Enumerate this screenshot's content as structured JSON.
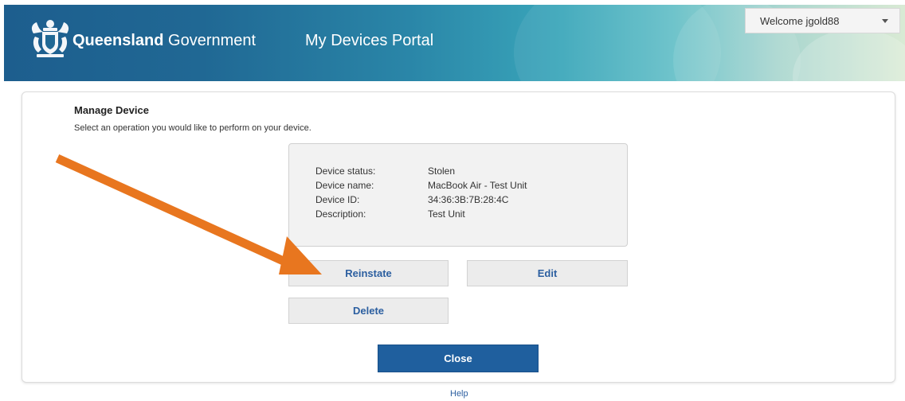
{
  "header": {
    "brand_strong": "Queensland",
    "brand_light": " Government",
    "portal_title": "My Devices Portal",
    "crest_icon": "queensland-crest-icon",
    "user_menu_label": "Welcome jgold88"
  },
  "panel": {
    "title": "Manage Device",
    "subtitle": "Select an operation you would like to perform on your device."
  },
  "device": {
    "status_label": "Device status:",
    "status_value": "Stolen",
    "name_label": "Device name:",
    "name_value": "MacBook Air - Test Unit",
    "id_label": "Device ID:",
    "id_value": "34:36:3B:7B:28:4C",
    "description_label": "Description:",
    "description_value": "Test Unit"
  },
  "actions": {
    "reinstate": "Reinstate",
    "edit": "Edit",
    "delete": "Delete",
    "close": "Close"
  },
  "annotation": {
    "arrow_color": "#e8761f"
  },
  "footer": {
    "help": "Help"
  },
  "colors": {
    "header_start": "#1d5e8e",
    "header_end": "#d9ead4",
    "primary_button": "#1f5f9e",
    "link": "#2c5fa0"
  }
}
